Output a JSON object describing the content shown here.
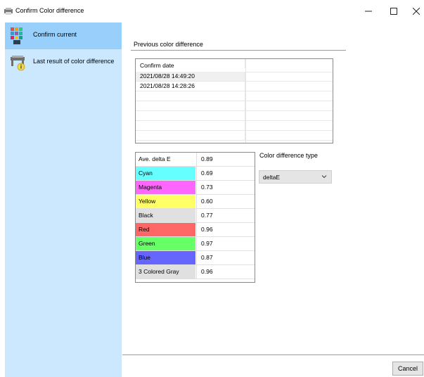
{
  "window": {
    "title": "Confirm Color difference",
    "controls": {
      "minimize": "—",
      "maximize": "☐",
      "close": "✕"
    }
  },
  "sidebar": {
    "items": [
      {
        "label": "Confirm current",
        "icon": "color-swatch-icon",
        "selected": true
      },
      {
        "label": "Last result of color difference",
        "icon": "printer-info-icon",
        "selected": false
      }
    ]
  },
  "main": {
    "group_title": "Previous color difference",
    "list": {
      "header": "Confirm date",
      "rows": [
        "2021/08/28 14:49:20",
        "2021/08/28 14:28:26",
        "",
        "",
        "",
        "",
        "",
        ""
      ],
      "selected_index": 0
    },
    "delta_table": [
      {
        "name": "Ave. delta E",
        "value": "0.89",
        "color": "#ffffff"
      },
      {
        "name": "Cyan",
        "value": "0.69",
        "color": "#66ffff"
      },
      {
        "name": "Magenta",
        "value": "0.73",
        "color": "#ff66ff"
      },
      {
        "name": "Yellow",
        "value": "0.60",
        "color": "#ffff66"
      },
      {
        "name": "Black",
        "value": "0.77",
        "color": "#e0e0e0"
      },
      {
        "name": "Red",
        "value": "0.96",
        "color": "#ff6666"
      },
      {
        "name": "Green",
        "value": "0.97",
        "color": "#66ff66"
      },
      {
        "name": "Blue",
        "value": "0.87",
        "color": "#6666ff"
      },
      {
        "name": "3 Colored Gray",
        "value": "0.96",
        "color": "#e0e0e0"
      }
    ],
    "color_difference_type": {
      "label": "Color difference type",
      "selected": "deltaE"
    }
  },
  "footer": {
    "cancel_label": "Cancel"
  }
}
